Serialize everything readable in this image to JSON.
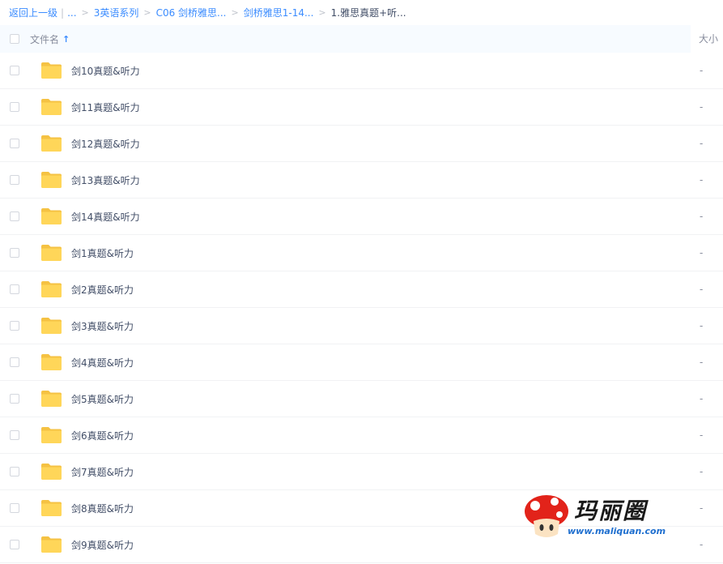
{
  "breadcrumb": {
    "back": "返回上一级",
    "ellipsis": "...",
    "items": [
      "3英语系列",
      "C06 剑桥雅思...",
      "剑桥雅思1-14..."
    ],
    "current": "1.雅思真题+听..."
  },
  "header": {
    "name_label": "文件名",
    "sort_icon": "arrow-up-icon",
    "size_label": "大小"
  },
  "files": [
    {
      "name": "剑10真题&听力",
      "size": "-"
    },
    {
      "name": "剑11真题&听力",
      "size": "-"
    },
    {
      "name": "剑12真题&听力",
      "size": "-"
    },
    {
      "name": "剑13真题&听力",
      "size": "-"
    },
    {
      "name": "剑14真题&听力",
      "size": "-"
    },
    {
      "name": "剑1真题&听力",
      "size": "-"
    },
    {
      "name": "剑2真题&听力",
      "size": "-"
    },
    {
      "name": "剑3真题&听力",
      "size": "-"
    },
    {
      "name": "剑4真题&听力",
      "size": "-"
    },
    {
      "name": "剑5真题&听力",
      "size": "-"
    },
    {
      "name": "剑6真题&听力",
      "size": "-"
    },
    {
      "name": "剑7真题&听力",
      "size": "-"
    },
    {
      "name": "剑8真题&听力",
      "size": "-"
    },
    {
      "name": "剑9真题&听力",
      "size": "-"
    }
  ],
  "watermark": {
    "title": "玛丽圈",
    "url": "www.maliquan.com"
  },
  "colors": {
    "link": "#3b8cff",
    "folder": "#ffd659",
    "header_bg": "#f7fbff",
    "text": "#424e67"
  }
}
